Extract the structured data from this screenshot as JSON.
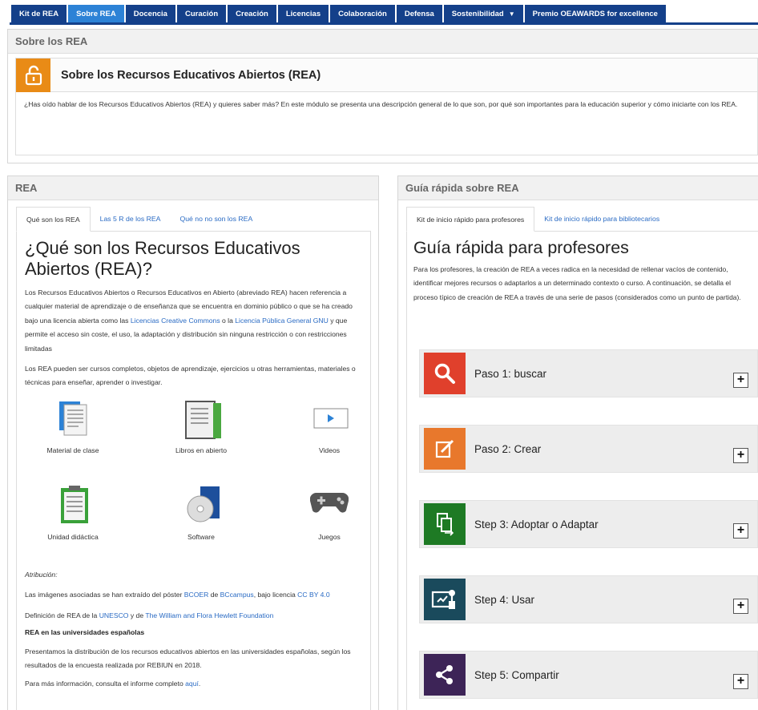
{
  "nav": {
    "tabs": [
      {
        "label": "Kit de REA"
      },
      {
        "label": "Sobre REA",
        "active": true
      },
      {
        "label": "Docencia"
      },
      {
        "label": "Curación"
      },
      {
        "label": "Creación"
      },
      {
        "label": "Licencias"
      },
      {
        "label": "Colaboración"
      },
      {
        "label": "Defensa"
      },
      {
        "label": "Sostenibilidad",
        "dropdown": true
      },
      {
        "label": "Premio OEAWARDS for excellence"
      }
    ],
    "colors": {
      "tab": "#14408a",
      "active": "#2c82d6"
    }
  },
  "intro": {
    "header": "Sobre los REA",
    "title": "Sobre los Recursos Educativos Abiertos (REA)",
    "icon": "lock-open-icon",
    "text": "¿Has oído hablar de los Recursos Educativos Abiertos (REA) y quieres saber más? En este módulo se presenta una descripción general de lo que son, por qué son importantes para la educación superior y cómo iniciarte con los REA."
  },
  "left": {
    "header": "REA",
    "tabs": [
      "Qué son los REA",
      "Las 5 R de los REA",
      "Qué no no son los REA"
    ],
    "heading": "¿Qué son los Recursos Educativos Abiertos (REA)?",
    "p1_a": "Los Recursos Educativos Abiertos o Recursos Educativos en Abierto (abreviado REA) hacen referencia a cualquier material de aprendizaje o de enseñanza que se encuentra en dominio público o que se ha creado bajo una licencia abierta como las ",
    "p1_link1": "Licencias Creative Commons",
    "p1_b": " o la ",
    "p1_link2": "Licencia Pública General GNU",
    "p1_c": " y que permite el acceso sin coste, el uso, la adaptación y distribución sin ninguna restricción o con restricciones limitadas",
    "p2": "Los REA pueden ser cursos completos, objetos de aprendizaje, ejercicios u otras herramientas, materiales o técnicas para enseñar, aprender o investigar.",
    "icons": [
      {
        "label": "Material de clase",
        "icon": "documents-icon"
      },
      {
        "label": "Libros en abierto",
        "icon": "book-icon"
      },
      {
        "label": "Videos",
        "icon": "video-icon"
      },
      {
        "label": "Unidad didáctica",
        "icon": "clipboard-icon"
      },
      {
        "label": "Software",
        "icon": "software-cd-icon"
      },
      {
        "label": "Juegos",
        "icon": "gamepad-icon"
      }
    ],
    "attribution_label": "Atribución:",
    "attr_a": "Las imágenes asociadas se han extraído del póster ",
    "attr_link1": "BCOER",
    "attr_b": " de ",
    "attr_link2": "BCcampus",
    "attr_c": ", bajo licencia ",
    "attr_link3": "CC BY 4.0",
    "def_a": "Definición de REA de la  ",
    "def_link1": "UNESCO",
    "def_b": " y de ",
    "def_link2": "The William and Flora Hewlett Foundation",
    "sub_heading": "REA en las universidades españolas",
    "p3": "Presentamos la distribución de los recursos educativos abiertos en las universidades españolas, según los resultados de la encuesta realizada por REBIUN en 2018.",
    "p4_a": "Para más información, consulta el informe completo ",
    "p4_link": "aquí",
    "p4_b": "."
  },
  "right": {
    "header": "Guía rápida sobre REA",
    "tabs": [
      "Kit de inicio rápido para profesores",
      "Kit de inicio rápido para bibliotecarios"
    ],
    "heading": "Guía rápida para profesores",
    "text": "Para los profesores, la creación de REA a veces radica en la necesidad de rellenar vacíos de contenido, identificar mejores recursos o adaptarlos a un determinado contexto o curso. A continuación, se detalla el proceso típico de creación de REA a través de una serie de pasos (considerados como un punto de partida).",
    "steps": [
      {
        "label": "Paso 1: buscar",
        "color": "#e0402c",
        "icon": "search-icon"
      },
      {
        "label": "Paso 2: Crear",
        "color": "#e8782c",
        "icon": "edit-icon"
      },
      {
        "label": "Step 3: Adoptar o Adaptar",
        "color": "#1e7a24",
        "icon": "adapt-icon"
      },
      {
        "label": "Step 4: Usar",
        "color": "#1a4a5c",
        "icon": "presentation-icon"
      },
      {
        "label": "Step 5: Compartir",
        "color": "#3d2457",
        "icon": "share-icon"
      }
    ],
    "expand": "+"
  }
}
